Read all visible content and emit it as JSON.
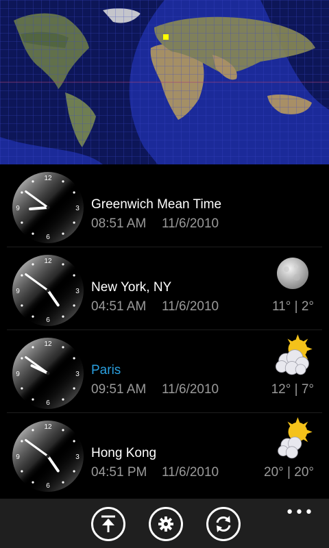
{
  "map": {
    "title": "",
    "sun_marker_color": "#ffff00"
  },
  "clocks": [
    {
      "city": "Greenwich Mean Time",
      "time": "08:51 AM",
      "date": "11/6/2010",
      "hour": 8,
      "minute": 51,
      "weather_icon": "",
      "temps": "",
      "highlight": false
    },
    {
      "city": "New York, NY",
      "time": "04:51 AM",
      "date": "11/6/2010",
      "hour": 4,
      "minute": 51,
      "weather_icon": "moon-icon",
      "temps": "11° | 2°",
      "highlight": false
    },
    {
      "city": "Paris",
      "time": "09:51 AM",
      "date": "11/6/2010",
      "hour": 9,
      "minute": 51,
      "weather_icon": "partly-cloudy-icon",
      "temps": "12° | 7°",
      "highlight": true
    },
    {
      "city": "Hong Kong",
      "time": "04:51 PM",
      "date": "11/6/2010",
      "hour": 16,
      "minute": 51,
      "weather_icon": "partly-cloudy-icon",
      "temps": "20° | 20°",
      "highlight": false
    }
  ],
  "clock_face_labels": {
    "top": "12",
    "right": "3",
    "bottom": "6",
    "left": "9"
  },
  "appbar": {
    "buttons": [
      {
        "name": "pin-to-start-button",
        "icon": "pin-up-icon"
      },
      {
        "name": "settings-button",
        "icon": "gear-icon"
      },
      {
        "name": "refresh-button",
        "icon": "sync-icon"
      }
    ],
    "more": "•••"
  },
  "colors": {
    "accent": "#2aa0e0",
    "secondary_text": "#9a9a9a",
    "background": "#000000",
    "appbar": "#1f1f1f"
  }
}
